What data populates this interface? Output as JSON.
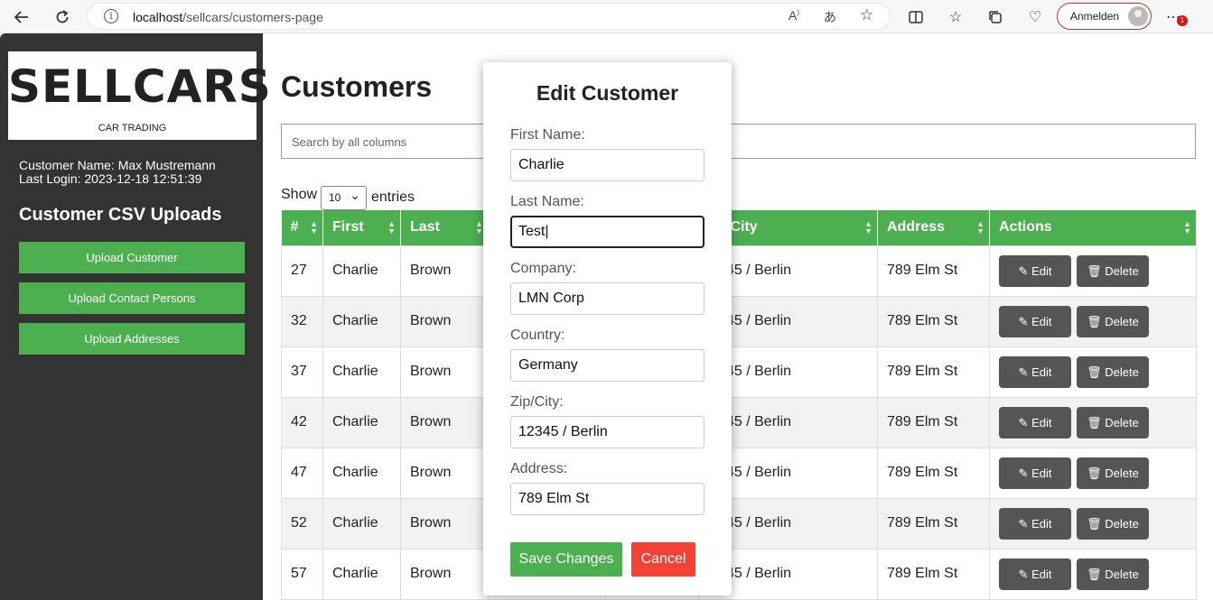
{
  "browser": {
    "url_host": "localhost",
    "url_path": "/sellcars/customers-page",
    "signin_label": "Anmelden",
    "notification_count": "1"
  },
  "sidebar": {
    "logo_text": "SELLCARS",
    "logo_subtitle": "CAR TRADING",
    "customer_name": "Customer Name: Max Mustremann",
    "last_login": "Last Login: 2023-12-18 12:51:39",
    "heading": "Customer CSV Uploads",
    "buttons": [
      "Upload Customer",
      "Upload Contact Persons",
      "Upload Addresses"
    ]
  },
  "main": {
    "title": "Customers",
    "search_placeholder": "Search by all columns",
    "show_label": "Show",
    "page_size": "10",
    "entries_label": "entries"
  },
  "table": {
    "headers": [
      "#",
      "First",
      "Last",
      "",
      "",
      "/City",
      "Address",
      "Actions"
    ],
    "edit_label": "Edit",
    "delete_label": "Delete",
    "rows": [
      {
        "id": "27",
        "first": "Charlie",
        "last": "Brown",
        "city": "45 / Berlin",
        "address": "789 Elm St"
      },
      {
        "id": "32",
        "first": "Charlie",
        "last": "Brown",
        "city": "45 / Berlin",
        "address": "789 Elm St"
      },
      {
        "id": "37",
        "first": "Charlie",
        "last": "Brown",
        "city": "45 / Berlin",
        "address": "789 Elm St"
      },
      {
        "id": "42",
        "first": "Charlie",
        "last": "Brown",
        "city": "45 / Berlin",
        "address": "789 Elm St"
      },
      {
        "id": "47",
        "first": "Charlie",
        "last": "Brown",
        "city": "45 / Berlin",
        "address": "789 Elm St"
      },
      {
        "id": "52",
        "first": "Charlie",
        "last": "Brown",
        "city": "45 / Berlin",
        "address": "789 Elm St"
      },
      {
        "id": "57",
        "first": "Charlie",
        "last": "Brown",
        "city": "45 / Berlin",
        "address": "789 Elm St"
      }
    ]
  },
  "modal": {
    "title": "Edit Customer",
    "fields": [
      {
        "label": "First Name:",
        "value": "Charlie"
      },
      {
        "label": "Last Name:",
        "value": "Test"
      },
      {
        "label": "Company:",
        "value": "LMN Corp"
      },
      {
        "label": "Country:",
        "value": "Germany"
      },
      {
        "label": "Zip/City:",
        "value": "12345 / Berlin"
      },
      {
        "label": "Address:",
        "value": "789 Elm St"
      }
    ],
    "save_label": "Save Changes",
    "cancel_label": "Cancel"
  },
  "colors": {
    "accent_green": "#4caf50",
    "danger_red": "#f44336",
    "sidebar_bg": "#333333",
    "action_button": "#555555"
  }
}
